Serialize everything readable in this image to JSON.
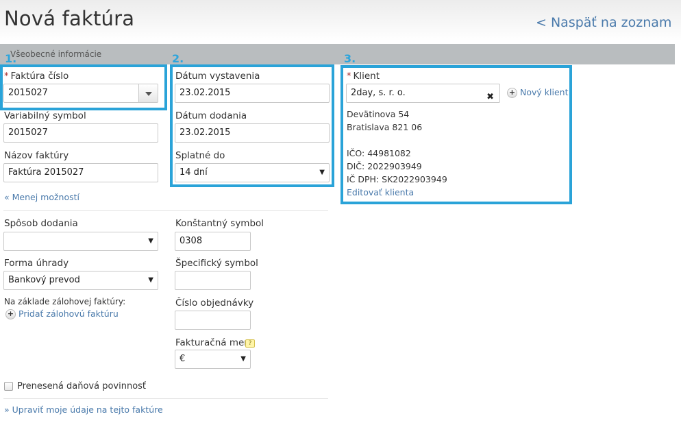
{
  "page": {
    "title": "Nová faktúra",
    "back_link": "< Naspäť na zoznam"
  },
  "section": {
    "label": "Všeobecné informácie"
  },
  "markers": {
    "one": "1.",
    "two": "2.",
    "three": "3."
  },
  "required_mark": "*",
  "invoice": {
    "number_label": "Faktúra číslo",
    "number_value": "2015027",
    "variable_symbol_label": "Variabilný symbol",
    "variable_symbol_value": "2015027",
    "name_label": "Názov faktúry",
    "name_value": "Faktúra 2015027",
    "less_options": "« Menej možností"
  },
  "dates": {
    "issue_label": "Dátum vystavenia",
    "issue_value": "23.02.2015",
    "delivery_label": "Dátum dodania",
    "delivery_value": "23.02.2015",
    "due_label": "Splatné do",
    "due_value": "14 dní"
  },
  "client": {
    "label": "Klient",
    "value": "2day, s. r. o.",
    "clear_icon": "✖",
    "new_client": "Nový klient",
    "address_line1": "Devätinova 54",
    "address_line2": "Bratislava 821 06",
    "ico": "IČO: 44981082",
    "dic": "DIČ: 2022903949",
    "ic_dph": "IČ DPH: SK2022903949",
    "edit": "Editovať klienta"
  },
  "options": {
    "delivery_method_label": "Spôsob dodania",
    "delivery_method_value": "",
    "payment_form_label": "Forma úhrady",
    "payment_form_value": "Bankový prevod",
    "advance_label": "Na základe zálohovej faktúry:",
    "advance_add": "Pridať zálohovú faktúru",
    "constant_symbol_label": "Konštantný symbol",
    "constant_symbol_value": "0308",
    "specific_symbol_label": "Špecifický symbol",
    "specific_symbol_value": "",
    "order_number_label": "Číslo objednávky",
    "order_number_value": "",
    "currency_label": "Fakturačná mena",
    "currency_value": "€",
    "currency_help": "?"
  },
  "tax": {
    "reverse_charge_label": "Prenesená daňová povinnosť",
    "reverse_charge_checked": false
  },
  "footer": {
    "edit_my_data": "» Upraviť moje údaje na tejto faktúre"
  },
  "icons": {
    "caret": "▼",
    "plus": "+"
  },
  "colors": {
    "highlight": "#2aa3d8",
    "link": "#4a7aab",
    "section_bar": "#b9bdbf",
    "required": "#a52a2a"
  }
}
